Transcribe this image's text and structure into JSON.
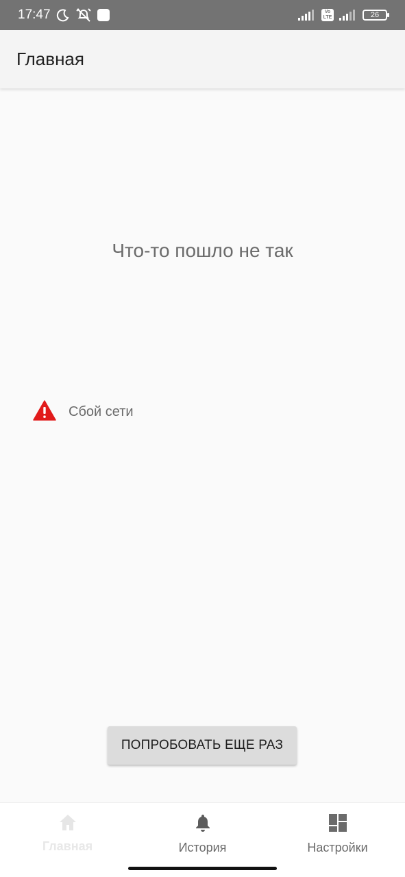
{
  "status_bar": {
    "time": "17:47",
    "icons_left": [
      "moon-icon",
      "alarm-off-icon",
      "square-icon"
    ],
    "icons_right": [
      "signal-icon",
      "volte-icon",
      "signal-icon",
      "battery-icon"
    ],
    "volte_line1": "Vo",
    "volte_line2": "LTE",
    "battery": "26"
  },
  "app_bar": {
    "title": "Главная"
  },
  "main": {
    "error_title": "Что-то пошло не так",
    "error_message": "Сбой сети",
    "retry_label": "ПОПРОБОВАТЬ ЕЩЕ РАЗ",
    "warning_color": "#e11b1b"
  },
  "bottom_nav": {
    "items": [
      {
        "label": "Главная",
        "icon": "home-icon",
        "active": true
      },
      {
        "label": "История",
        "icon": "bell-icon",
        "active": false
      },
      {
        "label": "Настройки",
        "icon": "dashboard-icon",
        "active": false
      }
    ]
  }
}
